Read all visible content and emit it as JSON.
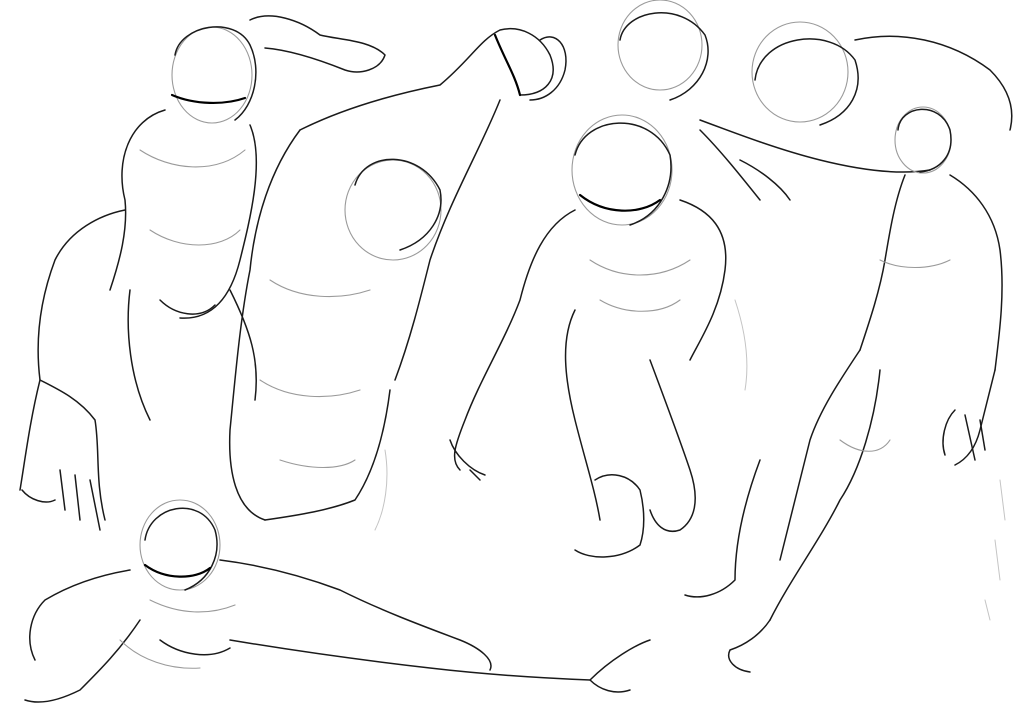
{
  "artwork": {
    "kind": "figure-sketch-sheet",
    "background_color": "#ffffff",
    "line_color": "#1a1a1a",
    "construction_line_color": "#9a9a9a",
    "figures": [
      {
        "pose": "lunging-reach",
        "view": "foreshortened-top"
      },
      {
        "pose": "reaching-up",
        "view": "from-above"
      },
      {
        "pose": "kneeling-crouch",
        "view": "front"
      },
      {
        "pose": "leaning-back-reach",
        "view": "from-above"
      },
      {
        "pose": "standing-arm-down",
        "view": "three-quarter-top"
      },
      {
        "pose": "low-split-stretch",
        "view": "front"
      }
    ]
  }
}
